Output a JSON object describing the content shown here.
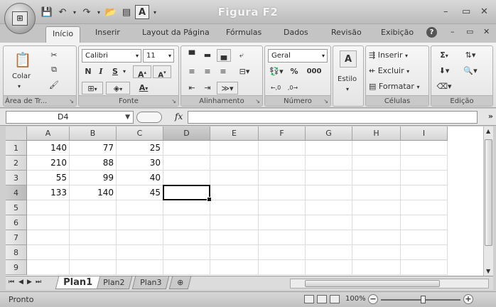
{
  "window": {
    "title": "Figura F2",
    "controls": {
      "minimize": "–",
      "maximize": "▭",
      "close": "✕"
    },
    "doc_controls": {
      "minimize": "–",
      "restore": "▭",
      "close": "✕"
    }
  },
  "quick_access": {
    "save": "💾",
    "undo": "↶",
    "redo": "↷"
  },
  "ribbon_tabs": [
    "Início",
    "Inserir",
    "Layout da Página",
    "Fórmulas",
    "Dados",
    "Revisão",
    "Exibição"
  ],
  "clipboard": {
    "paste_label": "Colar",
    "group_label": "Área de Tr..."
  },
  "font": {
    "font_name": "Calibri",
    "font_size": "11",
    "bold": "N",
    "italic": "I",
    "underline": "S",
    "grow": "A",
    "shrink": "A",
    "font_color": "A",
    "group_label": "Fonte"
  },
  "alignment": {
    "group_label": "Alinhamento"
  },
  "number": {
    "format": "Geral",
    "percent": "%",
    "thousands": "000",
    "inc_dec": ",00 ,0",
    "group_label": "Número"
  },
  "styles": {
    "label": "Estilo"
  },
  "cells": {
    "insert": "Inserir",
    "delete": "Excluir",
    "format": "Formatar",
    "group_label": "Células"
  },
  "editing": {
    "sum": "Σ",
    "group_label": "Edição"
  },
  "formula_bar": {
    "name_box": "D4",
    "fx": "fx",
    "formula": ""
  },
  "sheet": {
    "columns": [
      "A",
      "B",
      "C",
      "D",
      "E",
      "F",
      "G",
      "H",
      "I"
    ],
    "rows": [
      "1",
      "2",
      "3",
      "4",
      "5",
      "6",
      "7",
      "8",
      "9"
    ],
    "data": [
      [
        "140",
        "77",
        "25"
      ],
      [
        "210",
        "88",
        "30"
      ],
      [
        "55",
        "99",
        "40"
      ],
      [
        "133",
        "140",
        "45"
      ]
    ],
    "active_cell": "D4"
  },
  "sheet_tabs": [
    "Plan1",
    "Plan2",
    "Plan3"
  ],
  "status": {
    "text": "Pronto",
    "zoom": "100%"
  }
}
